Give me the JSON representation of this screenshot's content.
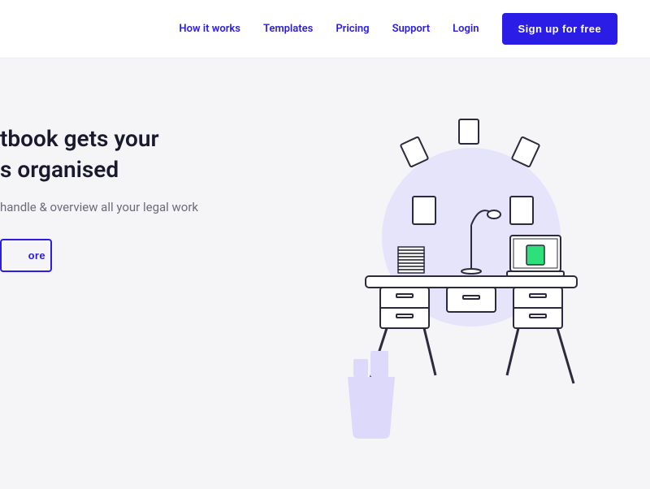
{
  "nav": {
    "how_it_works": "How it works",
    "templates": "Templates",
    "pricing": "Pricing",
    "support": "Support",
    "login": "Login",
    "signup": "Sign up for free"
  },
  "hero": {
    "title_line1": "tbook gets your",
    "title_line2": "s organised",
    "subtitle": "handle & overview all your legal work",
    "learn_more": "ore"
  }
}
